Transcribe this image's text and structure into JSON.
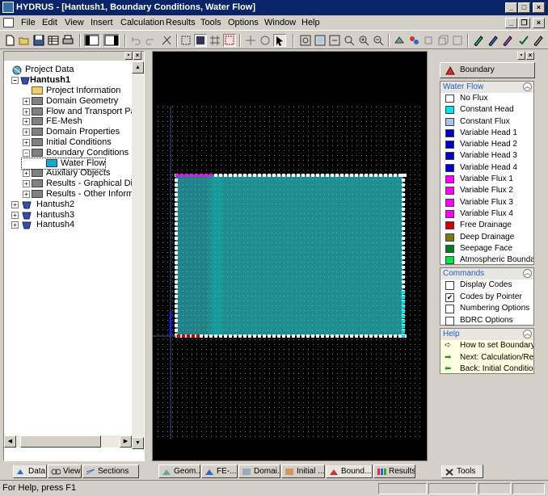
{
  "window": {
    "title": "HYDRUS - [Hantush1, Boundary Conditions, Water Flow]"
  },
  "menu": [
    "File",
    "Edit",
    "View",
    "Insert",
    "Calculation",
    "Results",
    "Tools",
    "Options",
    "Window",
    "Help"
  ],
  "tree": {
    "root": "Project Data",
    "project": "Hantush1",
    "items": [
      {
        "label": "Project Information",
        "depth": 2,
        "expand": ""
      },
      {
        "label": "Domain Geometry",
        "depth": 2,
        "expand": "+"
      },
      {
        "label": "Flow and Transport Para",
        "depth": 2,
        "expand": "+"
      },
      {
        "label": "FE-Mesh",
        "depth": 2,
        "expand": "+"
      },
      {
        "label": "Domain Properties",
        "depth": 2,
        "expand": "+"
      },
      {
        "label": "Initial Conditions",
        "depth": 2,
        "expand": "+"
      },
      {
        "label": "Boundary Conditions",
        "depth": 2,
        "expand": "-"
      },
      {
        "label": "Water Flow",
        "depth": 3,
        "expand": ""
      },
      {
        "label": "Auxilary Objects",
        "depth": 2,
        "expand": "+"
      },
      {
        "label": "Results - Graphical Displa",
        "depth": 2,
        "expand": "+"
      },
      {
        "label": "Results - Other Informat",
        "depth": 2,
        "expand": "+"
      }
    ],
    "other_projects": [
      "Hantush2",
      "Hantush3",
      "Hantush4"
    ]
  },
  "left_tabs": [
    "Data",
    "View",
    "Sections"
  ],
  "view_tabs": [
    "Geom...",
    "FE-...",
    "Domai...",
    "Initial ...",
    "Bound...",
    "Results"
  ],
  "right_panel": {
    "header_button": "Boundary Conditions",
    "water_flow_title": "Water Flow",
    "legend": [
      {
        "label": "No Flux",
        "color": "#ffffff"
      },
      {
        "label": "Constant Head",
        "color": "#00e5ee"
      },
      {
        "label": "Constant Flux",
        "color": "#a6c8ee"
      },
      {
        "label": "Variable Head 1",
        "color": "#0000cd"
      },
      {
        "label": "Variable Head 2",
        "color": "#0000cd"
      },
      {
        "label": "Variable Head 3",
        "color": "#0000cd"
      },
      {
        "label": "Variable Head 4",
        "color": "#0000cd"
      },
      {
        "label": "Variable Flux 1",
        "color": "#ff00ff"
      },
      {
        "label": "Variable Flux 2",
        "color": "#ff00ff"
      },
      {
        "label": "Variable Flux 3",
        "color": "#ff00ff"
      },
      {
        "label": "Variable Flux 4",
        "color": "#ff00ff"
      },
      {
        "label": "Free Drainage",
        "color": "#d40000"
      },
      {
        "label": "Deep Drainage",
        "color": "#7a7a14"
      },
      {
        "label": "Seepage Face",
        "color": "#007a1e"
      },
      {
        "label": "Atmospheric Boundary",
        "color": "#00e640"
      }
    ],
    "commands_title": "Commands",
    "commands": [
      {
        "label": "Display Codes",
        "checked": ""
      },
      {
        "label": "Codes by Pointer",
        "checked": "✔"
      },
      {
        "label": "Numbering Options",
        "checked": ""
      },
      {
        "label": "BDRC Options",
        "checked": ""
      }
    ],
    "help_title": "Help",
    "help": [
      {
        "label": "How to set Boundary ...",
        "icon": "pointer-icon"
      },
      {
        "label": "Next: Calculation/Res...",
        "icon": "arrow-right-icon"
      },
      {
        "label": "Back: Initial Conditions",
        "icon": "arrow-left-icon"
      }
    ]
  },
  "right_tab": "Tools",
  "status": "For Help, press F1"
}
